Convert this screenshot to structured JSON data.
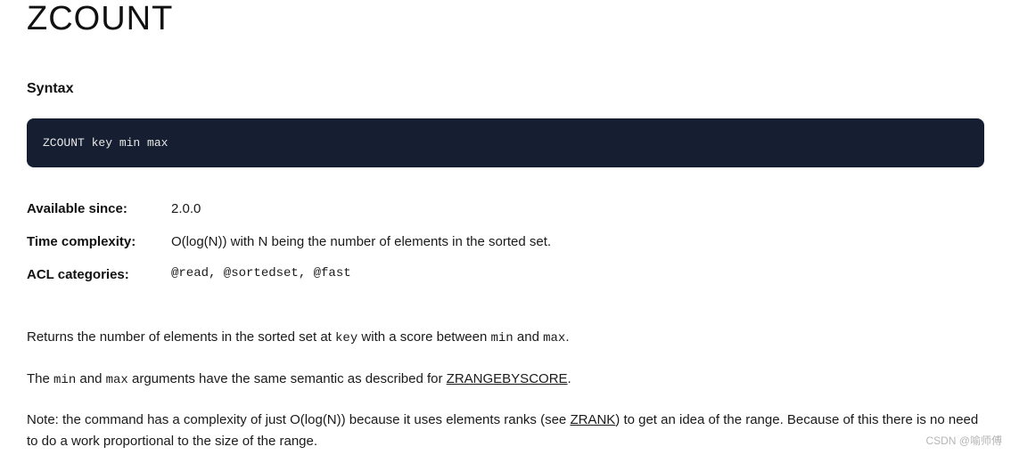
{
  "title": "ZCOUNT",
  "syntax_heading": "Syntax",
  "syntax_code": "ZCOUNT key min max",
  "meta": [
    {
      "label": "Available since:",
      "value_plain": "2.0.0",
      "value_mono": false
    },
    {
      "label": "Time complexity:",
      "value_plain": "O(log(N)) with N being the number of elements in the sorted set.",
      "value_mono": false
    },
    {
      "label": "ACL categories:",
      "value_plain": "@read, @sortedset, @fast",
      "value_mono": true
    }
  ],
  "desc": {
    "p1_pre": "Returns the number of elements in the sorted set at ",
    "p1_key": "key",
    "p1_mid": " with a score between ",
    "p1_min": "min",
    "p1_and": " and ",
    "p1_max": "max",
    "p1_end": ".",
    "p2_pre": "The ",
    "p2_min": "min",
    "p2_and": " and ",
    "p2_max": "max",
    "p2_mid": " arguments have the same semantic as described for ",
    "p2_link": "ZRANGEBYSCORE",
    "p2_end": ".",
    "p3_pre": "Note: the command has a complexity of just O(log(N)) because it uses elements ranks (see ",
    "p3_link": "ZRANK",
    "p3_post": ") to get an idea of the range. Because of this there is no need to do a work proportional to the size of the range."
  },
  "watermark": "CSDN @喻师傅"
}
